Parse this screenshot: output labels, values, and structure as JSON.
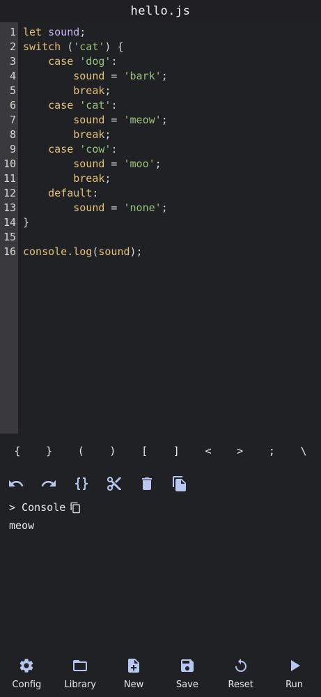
{
  "title": "hello.js",
  "editor": {
    "lines": [
      {
        "num": "1",
        "tokens": [
          [
            "kw",
            "let"
          ],
          [
            "plain",
            " "
          ],
          [
            "var",
            "sound"
          ],
          [
            "plain",
            ";"
          ]
        ]
      },
      {
        "num": "2",
        "tokens": [
          [
            "kw",
            "switch"
          ],
          [
            "plain",
            " ("
          ],
          [
            "str",
            "'cat'"
          ],
          [
            "plain",
            ") {"
          ]
        ]
      },
      {
        "num": "3",
        "tokens": [
          [
            "plain",
            "    "
          ],
          [
            "kw",
            "case"
          ],
          [
            "plain",
            " "
          ],
          [
            "str",
            "'dog'"
          ],
          [
            "plain",
            ":"
          ]
        ]
      },
      {
        "num": "4",
        "tokens": [
          [
            "plain",
            "        "
          ],
          [
            "kw",
            "sound"
          ],
          [
            "plain",
            " = "
          ],
          [
            "str",
            "'bark'"
          ],
          [
            "plain",
            ";"
          ]
        ]
      },
      {
        "num": "5",
        "tokens": [
          [
            "plain",
            "        "
          ],
          [
            "kw",
            "break"
          ],
          [
            "plain",
            ";"
          ]
        ]
      },
      {
        "num": "6",
        "tokens": [
          [
            "plain",
            "    "
          ],
          [
            "kw",
            "case"
          ],
          [
            "plain",
            " "
          ],
          [
            "str",
            "'cat'"
          ],
          [
            "plain",
            ":"
          ]
        ]
      },
      {
        "num": "7",
        "tokens": [
          [
            "plain",
            "        "
          ],
          [
            "kw",
            "sound"
          ],
          [
            "plain",
            " = "
          ],
          [
            "str",
            "'meow'"
          ],
          [
            "plain",
            ";"
          ]
        ]
      },
      {
        "num": "8",
        "tokens": [
          [
            "plain",
            "        "
          ],
          [
            "kw",
            "break"
          ],
          [
            "plain",
            ";"
          ]
        ]
      },
      {
        "num": "9",
        "tokens": [
          [
            "plain",
            "    "
          ],
          [
            "kw",
            "case"
          ],
          [
            "plain",
            " "
          ],
          [
            "str",
            "'cow'"
          ],
          [
            "plain",
            ":"
          ]
        ]
      },
      {
        "num": "10",
        "tokens": [
          [
            "plain",
            "        "
          ],
          [
            "kw",
            "sound"
          ],
          [
            "plain",
            " = "
          ],
          [
            "str",
            "'moo'"
          ],
          [
            "plain",
            ";"
          ]
        ]
      },
      {
        "num": "11",
        "tokens": [
          [
            "plain",
            "        "
          ],
          [
            "kw",
            "break"
          ],
          [
            "plain",
            ";"
          ]
        ]
      },
      {
        "num": "12",
        "tokens": [
          [
            "plain",
            "    "
          ],
          [
            "kw",
            "default"
          ],
          [
            "plain",
            ":"
          ]
        ]
      },
      {
        "num": "13",
        "tokens": [
          [
            "plain",
            "        "
          ],
          [
            "kw",
            "sound"
          ],
          [
            "plain",
            " = "
          ],
          [
            "str",
            "'none'"
          ],
          [
            "plain",
            ";"
          ]
        ]
      },
      {
        "num": "14",
        "tokens": [
          [
            "plain",
            "}"
          ]
        ]
      },
      {
        "num": "15",
        "tokens": []
      },
      {
        "num": "16",
        "tokens": [
          [
            "fn",
            "console.log"
          ],
          [
            "plain",
            "("
          ],
          [
            "fn",
            "sound"
          ],
          [
            "plain",
            ");"
          ]
        ]
      }
    ]
  },
  "symbols": [
    "{",
    "}",
    "(",
    ")",
    "[",
    "]",
    "<",
    ">",
    ";",
    "\\"
  ],
  "toolbar_icons": [
    "undo-icon",
    "redo-icon",
    "braces-icon",
    "cut-icon",
    "delete-icon",
    "copy-icon"
  ],
  "console": {
    "label": "> Console",
    "output": "meow"
  },
  "nav": [
    {
      "label": "Config",
      "icon": "gear-icon"
    },
    {
      "label": "Library",
      "icon": "folder-icon"
    },
    {
      "label": "New",
      "icon": "new-file-icon"
    },
    {
      "label": "Save",
      "icon": "save-icon"
    },
    {
      "label": "Reset",
      "icon": "reset-icon"
    },
    {
      "label": "Run",
      "icon": "play-icon"
    }
  ],
  "colors": {
    "background": "#202124",
    "gutter": "#3a3a3d",
    "keyword": "#e5c07b",
    "variable": "#c9b6f0",
    "string": "#98c379",
    "icon": "#b7c7ef"
  }
}
